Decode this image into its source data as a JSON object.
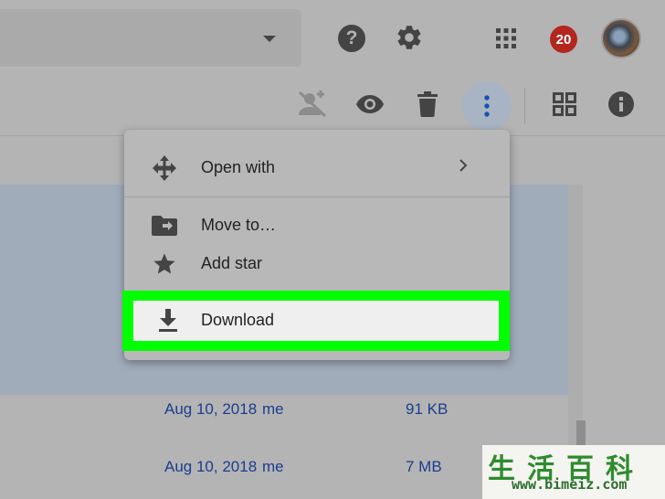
{
  "header": {
    "help_icon": "?",
    "notification_count": "20",
    "icons": [
      "caret-down-icon",
      "help-icon",
      "gear-icon",
      "apps-grid-icon",
      "notifications-badge",
      "avatar"
    ]
  },
  "toolbar": {
    "icons": [
      "remove-person-icon",
      "preview-eye-icon",
      "trash-icon",
      "more-vert-icon",
      "grid-view-icon",
      "info-icon"
    ]
  },
  "context_menu": {
    "items": [
      {
        "label": "Open with",
        "icon": "open-with-icon",
        "has_submenu": true
      },
      {
        "label": "Move to…",
        "icon": "move-to-folder-icon"
      },
      {
        "label": "Add star",
        "icon": "star-icon"
      },
      {
        "label": "Download",
        "icon": "download-icon",
        "highlighted": true
      }
    ],
    "highlight_color": "#00ff00"
  },
  "file_rows": [
    {
      "date": "Aug 10, 2018",
      "owner": "me",
      "size": "91 KB"
    },
    {
      "date": "Aug 10, 2018",
      "owner": "me",
      "size": "7 MB"
    }
  ],
  "watermark": {
    "chinese": "生活百科",
    "url": "www.bimeiz.com"
  },
  "colors": {
    "overlay": "#b4b4b4",
    "link_text": "#1a3d8f",
    "badge": "#b3261e",
    "selected_row": "#a1acbb"
  }
}
